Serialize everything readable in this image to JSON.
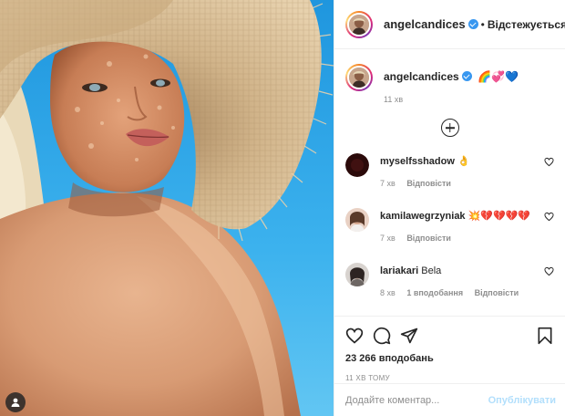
{
  "header": {
    "username": "angelcandices",
    "separator": "•",
    "follow_status": "Відстежується",
    "more_label": "⋯"
  },
  "caption": {
    "username": "angelcandices",
    "text": "🌈💞💙",
    "time": "11 хв"
  },
  "comments": [
    {
      "username": "myselfsshadow",
      "text": "👌",
      "time": "7 хв",
      "likes": "",
      "reply": "Відповісти",
      "avatar_color": "#2b0a0a"
    },
    {
      "username": "kamilawegrzyniak",
      "text": "💥💔💔💔💔",
      "time": "7 хв",
      "likes": "",
      "reply": "Відповісти",
      "avatar_color": "#d9b8a8"
    },
    {
      "username": "lariakari",
      "text": "Bela",
      "time": "8 хв",
      "likes": "1 вподобання",
      "reply": "Відповісти",
      "avatar_color": "#c7c2be"
    }
  ],
  "actions": {
    "likes_count": "23 266 вподобань",
    "post_time": "11 ХВ ТОМУ"
  },
  "add_comment": {
    "placeholder": "Додайте коментар...",
    "publish_label": "Опублікувати"
  },
  "icons": {
    "like": "heart-icon",
    "comment": "comment-icon",
    "share": "paper-plane-icon",
    "save": "bookmark-icon",
    "tags": "user-tag-icon",
    "load_more": "plus-circle-icon",
    "verified": "verified-badge-icon"
  },
  "colors": {
    "sky": "#2fa6e6",
    "link_blue": "#3897f0",
    "publish_disabled": "#b2dffc",
    "secondary_text": "#8e8e8e"
  }
}
